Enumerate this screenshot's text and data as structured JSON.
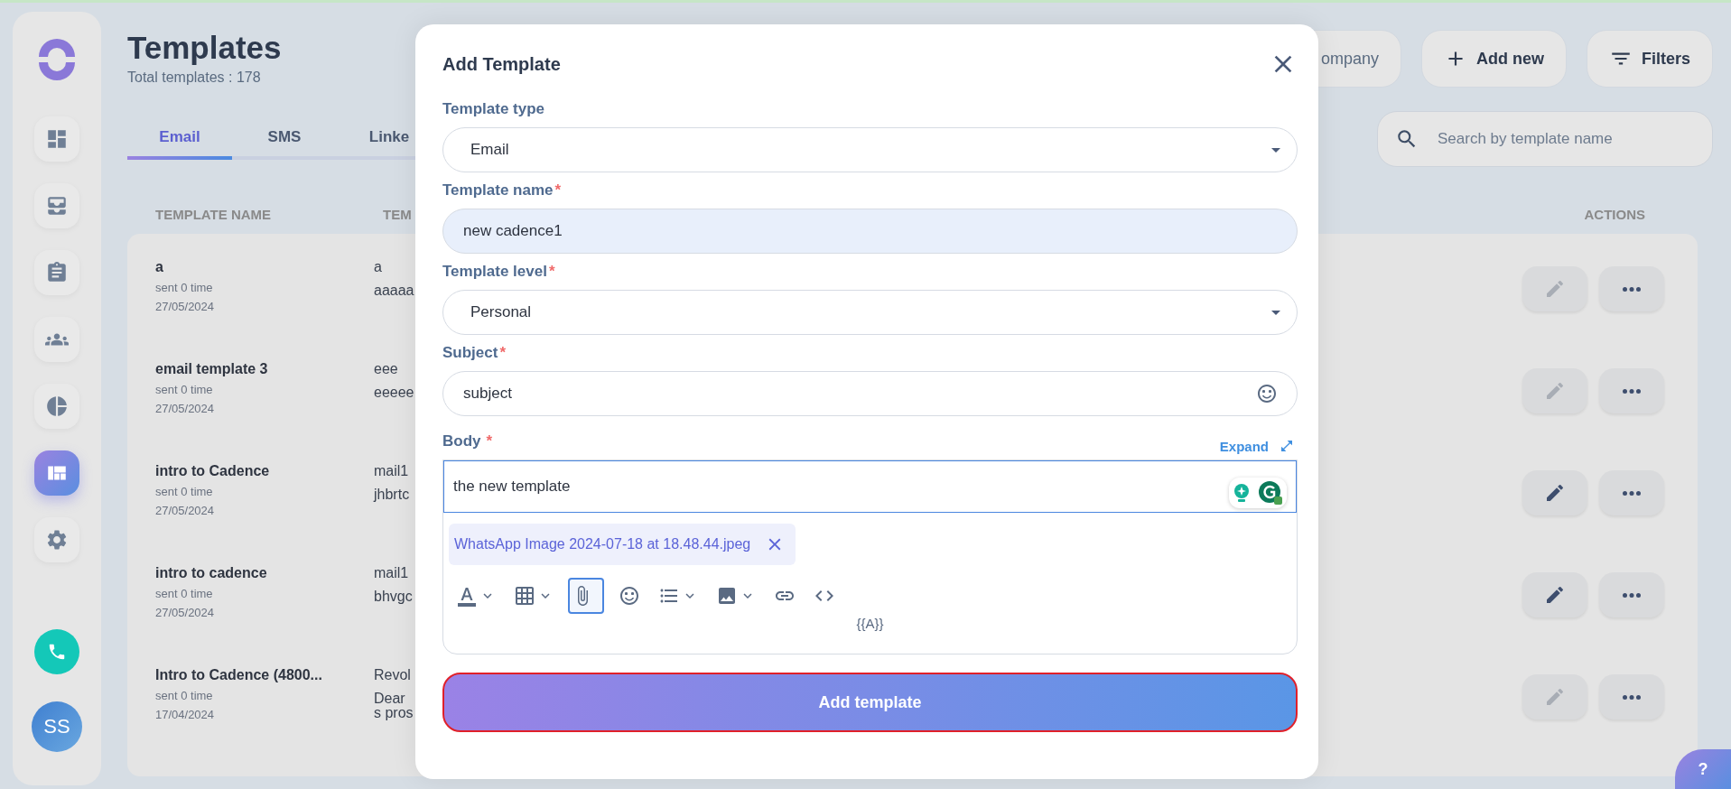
{
  "page": {
    "title": "Templates",
    "subtitle": "Total templates : 178"
  },
  "sidebar": {
    "items": [
      {
        "selected": false
      },
      {
        "selected": false
      },
      {
        "selected": false
      },
      {
        "selected": false
      },
      {
        "selected": false
      },
      {
        "selected": true
      },
      {
        "selected": false
      }
    ],
    "avatar": "SS"
  },
  "header_buttons": [
    {
      "label": "ompany"
    },
    {
      "label": "Add new"
    },
    {
      "label": "Filters"
    }
  ],
  "tabs": [
    {
      "label": "Email",
      "selected": true
    },
    {
      "label": "SMS",
      "selected": false
    },
    {
      "label": "Linke",
      "selected": false
    }
  ],
  "search": {
    "placeholder": "Search by template name"
  },
  "table": {
    "columns": [
      "TEMPLATE NAME",
      "TEM",
      "ACTIONS"
    ],
    "rows": [
      {
        "name": "a",
        "sent": "sent 0 time",
        "date": "27/05/2024",
        "column_2": [
          "a",
          "aaaaa"
        ],
        "edit_disabled": true
      },
      {
        "name": "email template 3",
        "sent": "sent 0 time",
        "date": "27/05/2024",
        "column_2": [
          "eee",
          "eeeee"
        ],
        "edit_disabled": true
      },
      {
        "name": "intro to Cadence",
        "sent": "sent 0 time",
        "date": "27/05/2024",
        "column_2": [
          "mail1",
          "jhbrtc"
        ],
        "edit_disabled": false
      },
      {
        "name": "intro to cadence",
        "sent": "sent 0 time",
        "date": "27/05/2024",
        "column_2": [
          "mail1",
          "bhvgc"
        ],
        "edit_disabled": false
      },
      {
        "name": "Intro to Cadence (4800...",
        "sent": "sent 0 time",
        "date": "17/04/2024",
        "column_2": [
          "Revol",
          "Dear",
          "s pros"
        ],
        "edit_disabled": true
      }
    ]
  },
  "modal": {
    "title": "Add Template",
    "fields": [
      {
        "kind": "select",
        "label": "Template type",
        "value": "Email",
        "highlighted": false
      },
      {
        "kind": "input",
        "label": "Template name",
        "required_mark": "*",
        "value": "new cadence1",
        "highlighted": true
      },
      {
        "kind": "select",
        "label": "Template level",
        "required_mark": "*",
        "value": "Personal",
        "highlighted": false
      },
      {
        "kind": "emoji-input",
        "label": "Subject",
        "required_mark": "*",
        "value": "subject",
        "highlighted": false
      }
    ],
    "body": {
      "label": "Body",
      "required_mark": "*",
      "expand": "Expand",
      "text": "the new template",
      "attachment": "WhatsApp Image 2024-07-18 at 18.48.44.jpeg",
      "tag": "{{A}}",
      "toolbar": [
        {
          "kind": "text-color",
          "menu": true,
          "selected": false
        },
        {
          "kind": "table",
          "menu": true,
          "selected": false
        },
        {
          "kind": "attachment",
          "menu": false,
          "selected": true
        },
        {
          "kind": "emoji",
          "menu": false,
          "selected": false
        },
        {
          "kind": "list",
          "menu": true,
          "selected": false
        },
        {
          "kind": "image",
          "menu": true,
          "selected": false
        },
        {
          "kind": "link",
          "menu": false,
          "selected": false
        },
        {
          "kind": "code",
          "menu": false,
          "selected": false
        }
      ]
    },
    "submit": "Add template"
  },
  "help": {
    "label": "?"
  }
}
